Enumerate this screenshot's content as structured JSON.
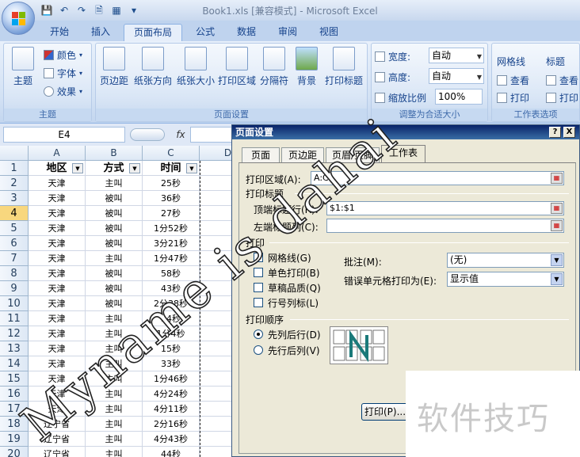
{
  "window": {
    "title": "Book1.xls  [兼容模式] - Microsoft Excel"
  },
  "tabs": [
    "开始",
    "插入",
    "页面布局",
    "公式",
    "数据",
    "审阅",
    "视图"
  ],
  "active_tab": "页面布局",
  "ribbon": {
    "themes": {
      "theme_label": "主题",
      "colors": "颜色",
      "fonts": "字体",
      "effects": "效果",
      "group": "主题"
    },
    "page_setup": {
      "margins": "页边距",
      "orientation": "纸张方向",
      "size": "纸张大小",
      "print_area": "打印区域",
      "breaks": "分隔符",
      "background": "背景",
      "print_titles": "打印标题",
      "group": "页面设置"
    },
    "scale": {
      "width_label": "宽度:",
      "width_value": "自动",
      "height_label": "高度:",
      "height_value": "自动",
      "scale_label": "缩放比例",
      "scale_value": "100%",
      "group": "调整为合适大小"
    },
    "sheet_options": {
      "gridlines": "网格线",
      "headings": "标题",
      "view1": "查看",
      "view2": "查看",
      "print1": "打印",
      "print2": "打印",
      "group": "工作表选项"
    }
  },
  "namebox": "E4",
  "fx": "fx",
  "columns": [
    "A",
    "B",
    "C",
    "D"
  ],
  "rows": [
    {
      "n": "1",
      "a": "地区",
      "b": "方式",
      "c": "时间"
    },
    {
      "n": "2",
      "a": "天津",
      "b": "主叫",
      "c": "25秒"
    },
    {
      "n": "3",
      "a": "天津",
      "b": "被叫",
      "c": "36秒"
    },
    {
      "n": "4",
      "a": "天津",
      "b": "被叫",
      "c": "27秒"
    },
    {
      "n": "5",
      "a": "天津",
      "b": "被叫",
      "c": "1分52秒"
    },
    {
      "n": "6",
      "a": "天津",
      "b": "被叫",
      "c": "3分21秒"
    },
    {
      "n": "7",
      "a": "天津",
      "b": "主叫",
      "c": "1分47秒"
    },
    {
      "n": "8",
      "a": "天津",
      "b": "被叫",
      "c": "58秒"
    },
    {
      "n": "9",
      "a": "天津",
      "b": "被叫",
      "c": "43秒"
    },
    {
      "n": "10",
      "a": "天津",
      "b": "被叫",
      "c": "2分38秒"
    },
    {
      "n": "11",
      "a": "天津",
      "b": "主叫",
      "c": "34秒"
    },
    {
      "n": "12",
      "a": "天津",
      "b": "主叫",
      "c": "1分4秒"
    },
    {
      "n": "13",
      "a": "天津",
      "b": "主叫",
      "c": "15秒"
    },
    {
      "n": "14",
      "a": "天津",
      "b": "主叫",
      "c": "33秒"
    },
    {
      "n": "15",
      "a": "天津",
      "b": "主叫",
      "c": "1分46秒"
    },
    {
      "n": "16",
      "a": "天津",
      "b": "主叫",
      "c": "4分24秒"
    },
    {
      "n": "17",
      "a": "天津",
      "b": "主叫",
      "c": "4分11秒"
    },
    {
      "n": "18",
      "a": "辽宁省",
      "b": "主叫",
      "c": "2分16秒"
    },
    {
      "n": "19",
      "a": "辽宁省",
      "b": "主叫",
      "c": "4分43秒"
    },
    {
      "n": "20",
      "a": "辽宁省",
      "b": "主叫",
      "c": "44秒"
    }
  ],
  "selected_row": "4",
  "dialog": {
    "title": "页面设置",
    "help": "?",
    "close": "X",
    "tabs": [
      "页面",
      "页边距",
      "页眉/页脚",
      "工作表"
    ],
    "active_tab": "工作表",
    "print_area_label": "打印区域(A):",
    "print_area_value": "A:C",
    "print_titles_label": "打印标题",
    "rows_repeat_label": "顶端标题行(R):",
    "rows_repeat_value": "$1:$1",
    "cols_repeat_label": "左端标题列(C):",
    "cols_repeat_value": "",
    "print_section": "打印",
    "checks": [
      "网格线(G)",
      "单色打印(B)",
      "草稿品质(Q)",
      "行号列标(L)"
    ],
    "comments_label": "批注(M):",
    "comments_value": "(无)",
    "errors_label": "错误单元格打印为(E):",
    "errors_value": "显示值",
    "order_section": "打印顺序",
    "order_options": [
      "先列后行(D)",
      "先行后列(V)"
    ],
    "print_button": "打印(P)..."
  },
  "watermark": "Myname is dahai",
  "brand": "软件技巧"
}
